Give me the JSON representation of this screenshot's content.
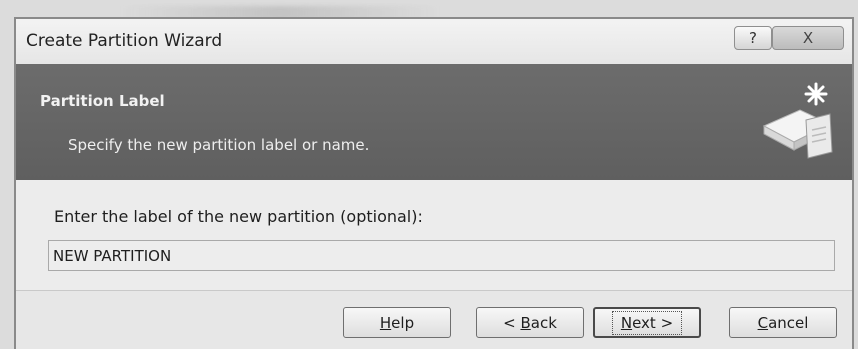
{
  "window": {
    "title": "Create Partition Wizard",
    "help_glyph": "?",
    "close_glyph": "X"
  },
  "header": {
    "title": "Partition Label",
    "subtitle": "Specify the new partition label or name.",
    "icon": "disk-partition-wizard-icon"
  },
  "form": {
    "label": "Enter the label of the new partition (optional):",
    "value": "NEW PARTITION"
  },
  "buttons": {
    "help": {
      "mnemonic": "H",
      "rest": "elp"
    },
    "back": {
      "prefix": "< ",
      "mnemonic": "B",
      "rest": "ack"
    },
    "next": {
      "mnemonic": "N",
      "rest": "ext >"
    },
    "cancel": {
      "mnemonic": "C",
      "rest": "ancel"
    }
  }
}
